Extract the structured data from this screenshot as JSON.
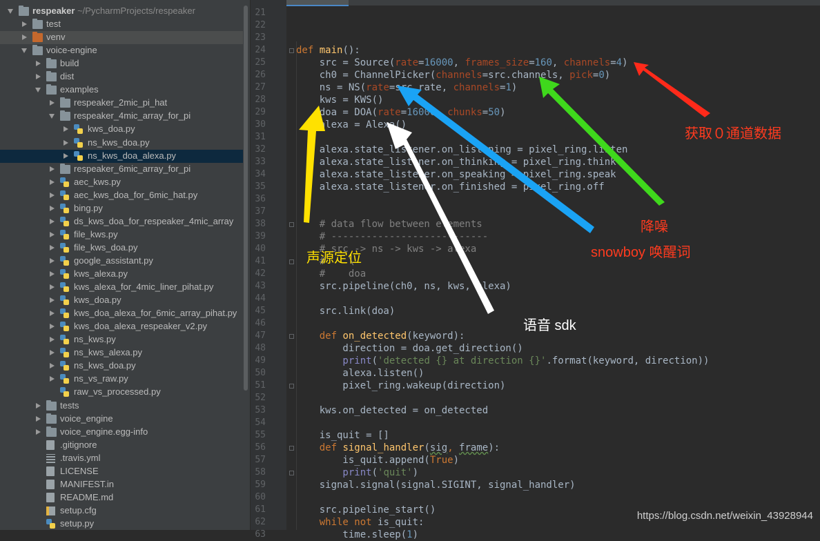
{
  "project_tree": {
    "root": {
      "label": "respeaker",
      "path": "~/PycharmProjects/respeaker"
    },
    "items": [
      {
        "label": "test",
        "icon": "folder-icon",
        "depth": 1,
        "expand": "closed"
      },
      {
        "label": "venv",
        "icon": "excluded-folder-icon",
        "depth": 1,
        "expand": "closed",
        "highlight": true
      },
      {
        "label": "voice-engine",
        "icon": "folder-icon",
        "depth": 1,
        "expand": "open"
      },
      {
        "label": "build",
        "icon": "folder-icon",
        "depth": 2,
        "expand": "closed"
      },
      {
        "label": "dist",
        "icon": "folder-icon",
        "depth": 2,
        "expand": "closed"
      },
      {
        "label": "examples",
        "icon": "folder-icon",
        "depth": 2,
        "expand": "open"
      },
      {
        "label": "respeaker_2mic_pi_hat",
        "icon": "folder-icon",
        "depth": 3,
        "expand": "closed"
      },
      {
        "label": "respeaker_4mic_array_for_pi",
        "icon": "folder-icon",
        "depth": 3,
        "expand": "open"
      },
      {
        "label": "kws_doa.py",
        "icon": "python-file-icon",
        "depth": 4,
        "expand": "closed"
      },
      {
        "label": "ns_kws_doa.py",
        "icon": "python-file-icon",
        "depth": 4,
        "expand": "closed"
      },
      {
        "label": "ns_kws_doa_alexa.py",
        "icon": "python-file-icon",
        "depth": 4,
        "expand": "closed",
        "selected": true
      },
      {
        "label": "respeaker_6mic_array_for_pi",
        "icon": "folder-icon",
        "depth": 3,
        "expand": "closed"
      },
      {
        "label": "aec_kws.py",
        "icon": "python-file-icon",
        "depth": 3,
        "expand": "closed"
      },
      {
        "label": "aec_kws_doa_for_6mic_hat.py",
        "icon": "python-file-icon",
        "depth": 3,
        "expand": "closed"
      },
      {
        "label": "bing.py",
        "icon": "python-file-icon",
        "depth": 3,
        "expand": "closed"
      },
      {
        "label": "ds_kws_doa_for_respeaker_4mic_array",
        "icon": "python-file-icon",
        "depth": 3,
        "expand": "closed"
      },
      {
        "label": "file_kws.py",
        "icon": "python-file-icon",
        "depth": 3,
        "expand": "closed"
      },
      {
        "label": "file_kws_doa.py",
        "icon": "python-file-icon",
        "depth": 3,
        "expand": "closed"
      },
      {
        "label": "google_assistant.py",
        "icon": "python-file-icon",
        "depth": 3,
        "expand": "closed"
      },
      {
        "label": "kws_alexa.py",
        "icon": "python-file-icon",
        "depth": 3,
        "expand": "closed"
      },
      {
        "label": "kws_alexa_for_4mic_liner_pihat.py",
        "icon": "python-file-icon",
        "depth": 3,
        "expand": "closed"
      },
      {
        "label": "kws_doa.py",
        "icon": "python-file-icon",
        "depth": 3,
        "expand": "closed"
      },
      {
        "label": "kws_doa_alexa_for_6mic_array_pihat.py",
        "icon": "python-file-icon",
        "depth": 3,
        "expand": "closed"
      },
      {
        "label": "kws_doa_alexa_respeaker_v2.py",
        "icon": "python-file-icon",
        "depth": 3,
        "expand": "closed"
      },
      {
        "label": "ns_kws.py",
        "icon": "python-file-icon",
        "depth": 3,
        "expand": "closed"
      },
      {
        "label": "ns_kws_alexa.py",
        "icon": "python-file-icon",
        "depth": 3,
        "expand": "closed"
      },
      {
        "label": "ns_kws_doa.py",
        "icon": "python-file-icon",
        "depth": 3,
        "expand": "closed"
      },
      {
        "label": "ns_vs_raw.py",
        "icon": "python-file-icon",
        "depth": 3,
        "expand": "closed"
      },
      {
        "label": "raw_vs_processed.py",
        "icon": "python-file-icon",
        "depth": 3,
        "expand": "none"
      },
      {
        "label": "tests",
        "icon": "folder-icon",
        "depth": 2,
        "expand": "closed"
      },
      {
        "label": "voice_engine",
        "icon": "folder-icon",
        "depth": 2,
        "expand": "closed"
      },
      {
        "label": "voice_engine.egg-info",
        "icon": "folder-icon",
        "depth": 2,
        "expand": "closed"
      },
      {
        "label": ".gitignore",
        "icon": "text-file-icon",
        "depth": 2,
        "expand": "none"
      },
      {
        "label": ".travis.yml",
        "icon": "yaml-file-icon",
        "depth": 2,
        "expand": "none"
      },
      {
        "label": "LICENSE",
        "icon": "text-file-icon",
        "depth": 2,
        "expand": "none"
      },
      {
        "label": "MANIFEST.in",
        "icon": "text-file-icon",
        "depth": 2,
        "expand": "none"
      },
      {
        "label": "README.md",
        "icon": "markdown-file-icon",
        "depth": 2,
        "expand": "none"
      },
      {
        "label": "setup.cfg",
        "icon": "config-file-icon",
        "depth": 2,
        "expand": "none"
      },
      {
        "label": "setup.py",
        "icon": "python-file-icon",
        "depth": 2,
        "expand": "none"
      }
    ]
  },
  "editor": {
    "first_line": 21,
    "lines": [
      [],
      [],
      [],
      [
        [
          "kw",
          "def "
        ],
        [
          "fn",
          "main"
        ],
        [
          "",
          "():"
        ]
      ],
      [
        [
          "",
          "    src = Source("
        ],
        [
          "par",
          "rate"
        ],
        [
          "",
          "="
        ],
        [
          "num",
          "16000"
        ],
        [
          "",
          ", "
        ],
        [
          "par",
          "frames_size"
        ],
        [
          "",
          "="
        ],
        [
          "num",
          "160"
        ],
        [
          "",
          ", "
        ],
        [
          "par",
          "channels"
        ],
        [
          "",
          "="
        ],
        [
          "num",
          "4"
        ],
        [
          "",
          ")"
        ]
      ],
      [
        [
          "",
          "    ch0 = ChannelPicker("
        ],
        [
          "par",
          "channels"
        ],
        [
          "",
          "=src.channels, "
        ],
        [
          "par",
          "pick"
        ],
        [
          "",
          "="
        ],
        [
          "num",
          "0"
        ],
        [
          "",
          ")"
        ]
      ],
      [
        [
          "",
          "    ns = NS("
        ],
        [
          "par",
          "rate"
        ],
        [
          "",
          "=src.rate, "
        ],
        [
          "par",
          "channels"
        ],
        [
          "",
          "="
        ],
        [
          "num",
          "1"
        ],
        [
          "",
          ")"
        ]
      ],
      [
        [
          "",
          "    kws = KWS()"
        ]
      ],
      [
        [
          "",
          "    doa = DOA("
        ],
        [
          "par",
          "rate"
        ],
        [
          "",
          "="
        ],
        [
          "num",
          "16000"
        ],
        [
          "",
          ", "
        ],
        [
          "par",
          "chunks"
        ],
        [
          "",
          "="
        ],
        [
          "num",
          "50"
        ],
        [
          "",
          ")"
        ]
      ],
      [
        [
          "",
          "    alexa = Alexa()"
        ]
      ],
      [],
      [
        [
          "",
          "    alexa.state_listener.on_listening = pixel_ring.listen"
        ]
      ],
      [
        [
          "",
          "    alexa.state_listener.on_thinking = pixel_ring.think"
        ]
      ],
      [
        [
          "",
          "    alexa.state_listener.on_speaking = pixel_ring.speak"
        ]
      ],
      [
        [
          "",
          "    alexa.state_listener.on_finished = pixel_ring.off"
        ]
      ],
      [],
      [],
      [
        [
          "com",
          "    # data flow between elements"
        ]
      ],
      [
        [
          "com",
          "    # ---------------------------"
        ]
      ],
      [
        [
          "com",
          "    # src -> ns -> kws -> alexa"
        ]
      ],
      [
        [
          "com",
          "    #    \\"
        ]
      ],
      [
        [
          "com",
          "    #    doa"
        ]
      ],
      [
        [
          "",
          "    src.pipeline(ch0, ns, kws, alexa)"
        ]
      ],
      [],
      [
        [
          "",
          "    src.link(doa)"
        ]
      ],
      [],
      [
        [
          "kw",
          "    def "
        ],
        [
          "fn",
          "on_detected"
        ],
        [
          "",
          "(keyword):"
        ]
      ],
      [
        [
          "",
          "        direction = doa.get_direction()"
        ]
      ],
      [
        [
          "bi",
          "        print"
        ],
        [
          "",
          "("
        ],
        [
          "str",
          "'detected {} at direction {}'"
        ],
        [
          "",
          ".format(keyword, direction))"
        ]
      ],
      [
        [
          "",
          "        alexa.listen()"
        ]
      ],
      [
        [
          "",
          "        pixel_ring.wakeup(direction)"
        ]
      ],
      [],
      [
        [
          "",
          "    kws.on_detected = on_detected"
        ]
      ],
      [],
      [
        [
          "",
          "    is_quit = []"
        ]
      ],
      [
        [
          "kw",
          "    def "
        ],
        [
          "fn",
          "signal_handler"
        ],
        [
          "",
          "("
        ],
        [
          "sq",
          "sig"
        ],
        [
          "kw",
          ", "
        ],
        [
          "sq",
          "frame"
        ],
        [
          "",
          "):"
        ]
      ],
      [
        [
          "",
          "        is_quit.append("
        ],
        [
          "kw",
          "True"
        ],
        [
          "",
          ")"
        ]
      ],
      [
        [
          "bi",
          "        print"
        ],
        [
          "",
          "("
        ],
        [
          "str",
          "'quit'"
        ],
        [
          "",
          ")"
        ]
      ],
      [
        [
          "",
          "    signal.signal(signal.SIGINT, signal_handler)"
        ]
      ],
      [],
      [
        [
          "",
          "    src.pipeline_start()"
        ]
      ],
      [
        [
          "kw",
          "    while not "
        ],
        [
          "",
          "is_quit:"
        ]
      ],
      [
        [
          "",
          "        time.sleep("
        ],
        [
          "num",
          "1"
        ],
        [
          "",
          ")"
        ]
      ]
    ]
  },
  "annotations": [
    {
      "text": "获取０通道数据",
      "color": "#ff3b1f"
    },
    {
      "text": "降噪",
      "color": "#ff3b1f"
    },
    {
      "text": "snowboy 唤醒词",
      "color": "#ff3b1f"
    },
    {
      "text": "声源定位",
      "color": "#ffe100"
    },
    {
      "text": "语音 sdk",
      "color": "#ffffff"
    }
  ],
  "arrow_colors": {
    "red": "#ff2a1a",
    "green": "#3fd81c",
    "blue": "#1aa3f5",
    "yellow": "#ffe100",
    "white": "#ffffff"
  },
  "watermark": "https://blog.csdn.net/weixin_43928944"
}
